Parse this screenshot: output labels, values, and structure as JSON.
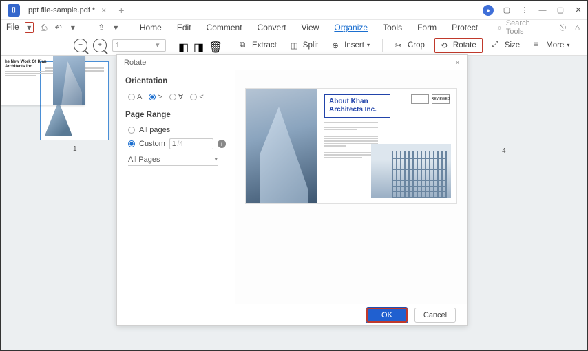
{
  "titlebar": {
    "filename": "ppt file-sample.pdf *",
    "menu_file": "File"
  },
  "menu": {
    "home": "Home",
    "edit": "Edit",
    "comment": "Comment",
    "convert": "Convert",
    "view": "View",
    "organize": "Organize",
    "tools": "Tools",
    "form": "Form",
    "protect": "Protect"
  },
  "search": {
    "placeholder": "Search Tools"
  },
  "toolbar": {
    "page_value": "1",
    "extract": "Extract",
    "split": "Split",
    "insert": "Insert",
    "crop": "Crop",
    "rotate": "Rotate",
    "size": "Size",
    "more": "More"
  },
  "thumbnails": {
    "page1": "1",
    "page4": "4",
    "page4_title": "he New Work Of Klan Architects Inc."
  },
  "dialog": {
    "title": "Rotate",
    "orientation_label": "Orientation",
    "orient_a": "A",
    "orient_right": ">",
    "orient_flip": "∀",
    "orient_left": "<",
    "page_range_label": "Page Range",
    "all_pages": "All pages",
    "custom": "Custom",
    "custom_value": "1",
    "custom_hint": "/4",
    "all_pages_dd": "All Pages",
    "preview_title": "About Khan Architects Inc.",
    "badge_reviewed": "REVIEWED",
    "ok": "OK",
    "cancel": "Cancel"
  }
}
